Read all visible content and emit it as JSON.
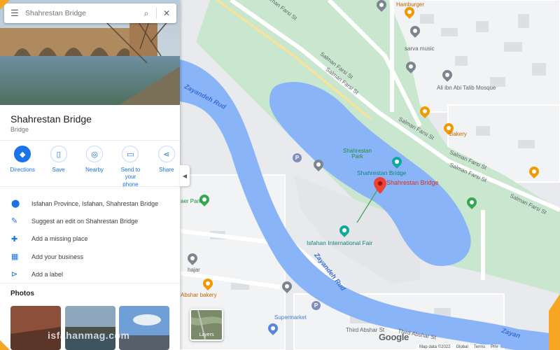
{
  "search": {
    "value": "Shahrestan Bridge"
  },
  "place": {
    "name": "Shahrestan Bridge",
    "category": "Bridge"
  },
  "actions": [
    {
      "label": "Directions",
      "icon": "directions-icon"
    },
    {
      "label": "Save",
      "icon": "bookmark-icon"
    },
    {
      "label": "Nearby",
      "icon": "nearby-icon"
    },
    {
      "label": "Send to your phone",
      "icon": "phone-icon"
    },
    {
      "label": "Share",
      "icon": "share-icon"
    }
  ],
  "info": [
    {
      "text": "Isfahan Province, Isfahan, Shahrestan Bridge",
      "icon": "location-pin-icon"
    },
    {
      "text": "Suggest an edit on Shahrestan Bridge",
      "icon": "pencil-icon"
    },
    {
      "text": "Add a missing place",
      "icon": "add-place-icon"
    },
    {
      "text": "Add your business",
      "icon": "add-business-icon"
    },
    {
      "text": "Add a label",
      "icon": "label-icon"
    }
  ],
  "photos_title": "Photos",
  "map": {
    "streets": {
      "s1": "Salman Farsi St",
      "s2": "Salman Farsi St",
      "s3": "Salman Farsi St",
      "s4": "Salman Farsi St",
      "s5": "Salman Farsi St",
      "s6": "Salman Farsi St",
      "s7": "Salman Farsi St",
      "third1": "Third Abshar St",
      "third2": "Third Abshar St"
    },
    "river": {
      "r1": "Zayandeh Rud",
      "r2": "Zayandeh Rud",
      "r3": "Zayan"
    },
    "pois": {
      "park": "Shahrestan\nPark",
      "bridge_fa_en": "Shahrestan Bridge",
      "bridge_marker": "Shahrestan Bridge",
      "fair": "Isfahan International Fair",
      "mosque": "Ali ibn Abi Talib Mosque",
      "sarva": "sarva music",
      "bakery": "Bakery",
      "hajar": "hajar",
      "abshar_bakery": "Abshar bakery",
      "supermarket": "Supermarket",
      "hamburger": "Hamburger",
      "aer_park": "aer Park"
    }
  },
  "controls": {
    "layers_label": "Layers",
    "google": "Google",
    "footer": [
      "Map data ©2022",
      "Global",
      "Terms",
      "Priv"
    ]
  },
  "watermark": "isfahanmag.com",
  "colors": {
    "accent": "#1a73e8",
    "water": "#8ab4f8",
    "park": "#c8e6c9",
    "marker": "#ea4335"
  }
}
